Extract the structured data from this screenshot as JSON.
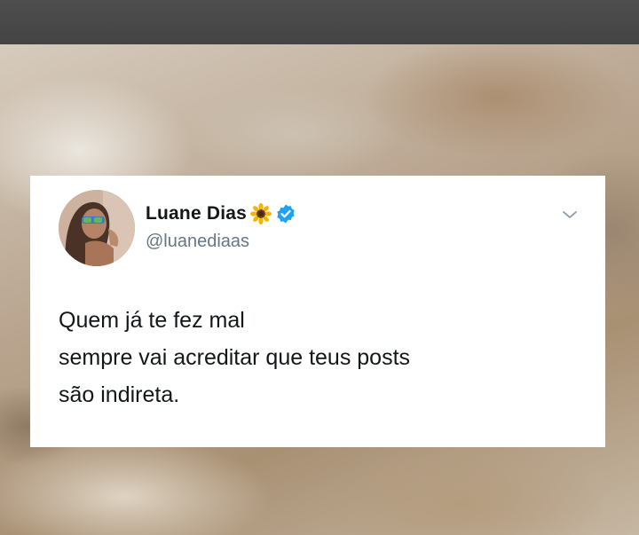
{
  "tweet": {
    "display_name": "Luane Dias",
    "handle": "@luanediaas",
    "name_emoji_icon": "sunflower-icon",
    "verified_icon": "verified-badge-icon",
    "menu_icon": "chevron-down-icon",
    "text_lines": [
      "Quem já te fez mal",
      "sempre vai acreditar que teus posts",
      "são indireta."
    ]
  },
  "colors": {
    "card_background": "#ffffff",
    "name_text": "#14171a",
    "handle_text": "#657786",
    "verified_blue": "#1da1f2",
    "top_bar": "#4a4a4a"
  }
}
